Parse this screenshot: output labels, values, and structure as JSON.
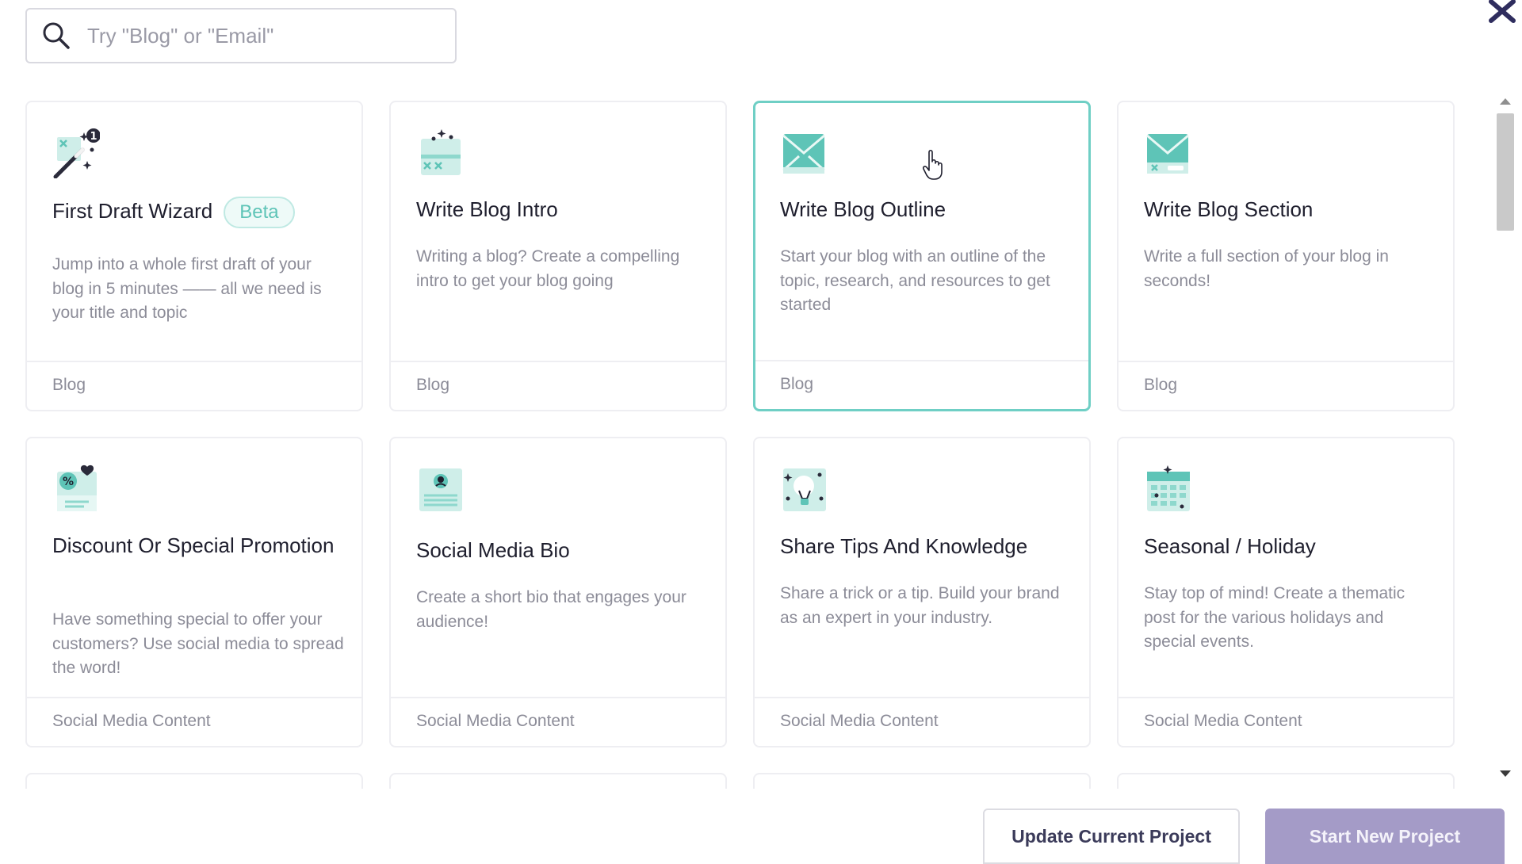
{
  "search": {
    "placeholder": "Try \"Blog\" or \"Email\"",
    "value": "",
    "icon": "search-icon"
  },
  "close_icon": "close-icon",
  "colors": {
    "accent": "#6fcfc5",
    "icon_teal": "#5ec4b7",
    "icon_dark": "#2a2a3a",
    "primary_button": "#a49bc7"
  },
  "cards": [
    {
      "title": "First Draft Wizard",
      "badge": "Beta",
      "description": "Jump into a whole first draft of your blog in 5 minutes —— all we need is your title and topic",
      "category": "Blog",
      "icon": "magic-wand-icon",
      "selected": false
    },
    {
      "title": "Write Blog Intro",
      "badge": "",
      "description": "Writing a blog? Create a compelling intro to get your blog going",
      "category": "Blog",
      "icon": "blog-intro-icon",
      "selected": false
    },
    {
      "title": "Write Blog Outline",
      "badge": "",
      "description": "Start your blog with an outline of the topic, research, and resources to get started",
      "category": "Blog",
      "icon": "blog-outline-icon",
      "selected": true
    },
    {
      "title": "Write Blog Section",
      "badge": "",
      "description": "Write a full section of your blog in seconds!",
      "category": "Blog",
      "icon": "blog-section-icon",
      "selected": false
    },
    {
      "title": "Discount Or Special Promotion",
      "badge": "",
      "description": "Have something special to offer your customers? Use social media to spread the word!",
      "category": "Social Media Content",
      "icon": "discount-icon",
      "selected": false
    },
    {
      "title": "Social Media Bio",
      "badge": "",
      "description": "Create a short bio that engages your audience!",
      "category": "Social Media Content",
      "icon": "profile-bio-icon",
      "selected": false
    },
    {
      "title": "Share Tips And Knowledge",
      "badge": "",
      "description": "Share a trick or a tip. Build your brand as an expert in your industry.",
      "category": "Social Media Content",
      "icon": "lightbulb-icon",
      "selected": false
    },
    {
      "title": "Seasonal / Holiday",
      "badge": "",
      "description": "Stay top of mind! Create a thematic post for the various holidays and special events.",
      "category": "Social Media Content",
      "icon": "calendar-icon",
      "selected": false
    }
  ],
  "buttons": {
    "update": "Update Current Project",
    "start": "Start New Project"
  }
}
